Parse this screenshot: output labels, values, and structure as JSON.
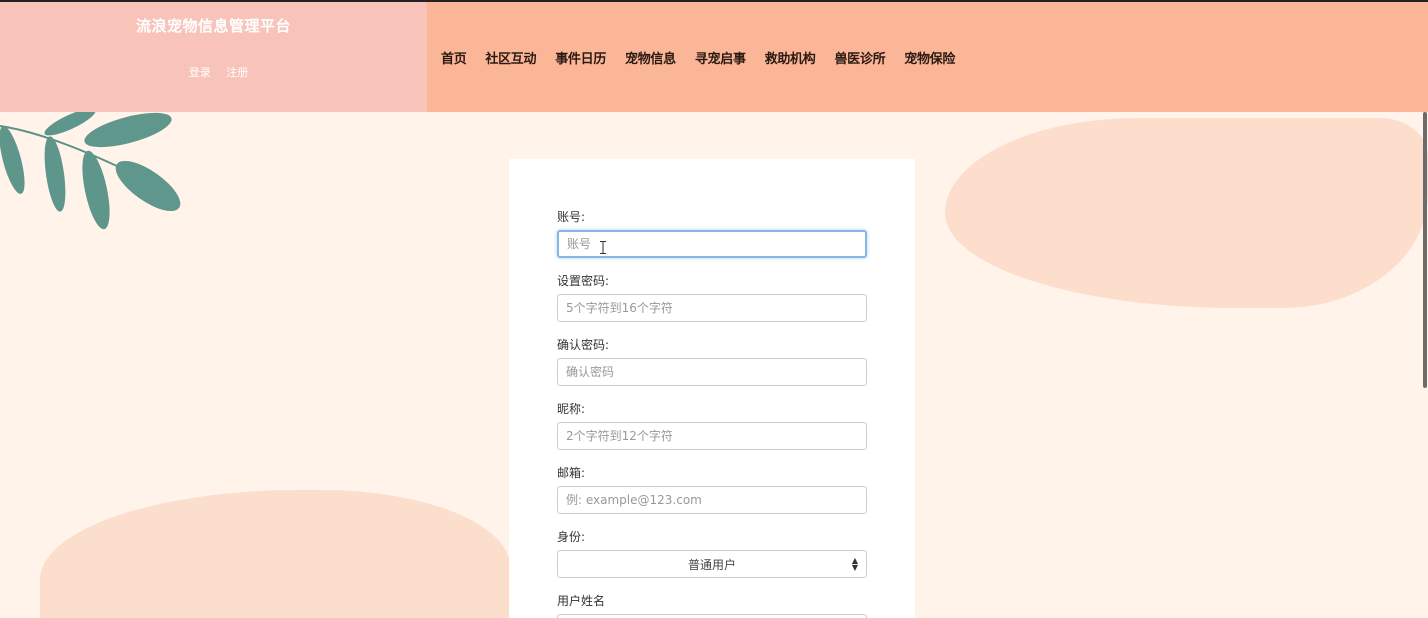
{
  "header": {
    "site_title": "流浪宠物信息管理平台",
    "login_link": "登录",
    "register_link": "注册"
  },
  "nav": {
    "items": [
      {
        "label": "首页"
      },
      {
        "label": "社区互动"
      },
      {
        "label": "事件日历"
      },
      {
        "label": "宠物信息"
      },
      {
        "label": "寻宠启事"
      },
      {
        "label": "救助机构"
      },
      {
        "label": "兽医诊所"
      },
      {
        "label": "宠物保险"
      }
    ]
  },
  "form": {
    "account": {
      "label": "账号:",
      "placeholder": "账号",
      "value": ""
    },
    "password": {
      "label": "设置密码:",
      "placeholder": "5个字符到16个字符",
      "value": ""
    },
    "confirm_password": {
      "label": "确认密码:",
      "placeholder": "确认密码",
      "value": ""
    },
    "nickname": {
      "label": "昵称:",
      "placeholder": "2个字符到12个字符",
      "value": ""
    },
    "email": {
      "label": "邮箱:",
      "placeholder": "例: example@123.com",
      "value": ""
    },
    "identity": {
      "label": "身份:",
      "selected": "普通用户"
    },
    "real_name": {
      "label": "用户姓名"
    }
  },
  "colors": {
    "brand_bg": "#f8c3b8",
    "nav_bg": "#fbb697",
    "page_bg": "#fff3ea",
    "focus_border": "#8ab8e6"
  }
}
